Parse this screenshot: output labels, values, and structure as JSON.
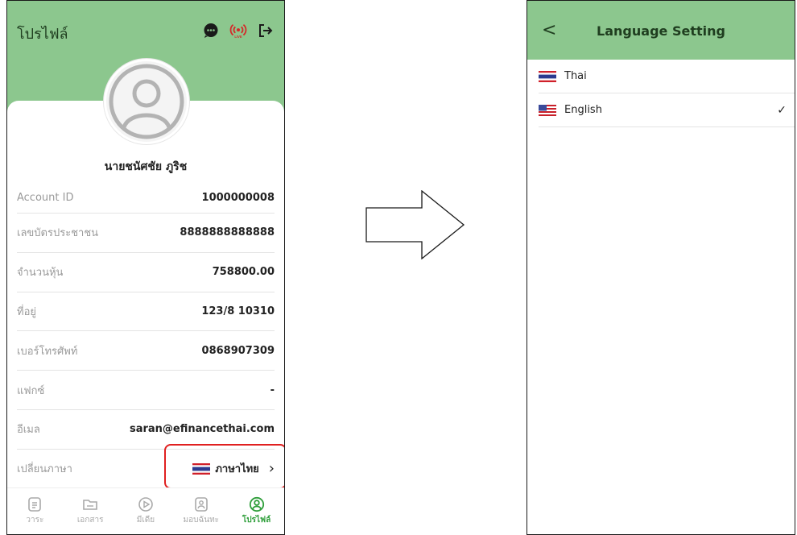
{
  "left_screen": {
    "title": "โปรไฟล์",
    "header_icons": [
      "chat-icon",
      "live-icon",
      "logout-icon"
    ],
    "live_label": "LIVE",
    "user_name": "นายชนัศชัย ภูริช",
    "info": [
      {
        "label": "Account ID",
        "value": "1000000008"
      },
      {
        "label": "เลขบัตรประชาชน",
        "value": "8888888888888"
      },
      {
        "label": "จำนวนหุ้น",
        "value": "758800.00"
      },
      {
        "label": "ที่อยู่",
        "value": "123/8 10310"
      },
      {
        "label": "เบอร์โทรศัพท์",
        "value": "0868907309"
      },
      {
        "label": "แฟกซ์",
        "value": "-"
      },
      {
        "label": "อีเมล",
        "value": "saran@efinancethai.com"
      }
    ],
    "language_row": {
      "label": "เปลี่ยนภาษา",
      "value": "ภาษาไทย",
      "chevron": "›"
    },
    "nav": [
      {
        "label": "วาระ",
        "icon": "agenda-icon"
      },
      {
        "label": "เอกสาร",
        "icon": "folder-icon"
      },
      {
        "label": "มีเดีย",
        "icon": "play-icon"
      },
      {
        "label": "มอบฉันทะ",
        "icon": "proxy-icon"
      },
      {
        "label": "โปรไฟล์",
        "icon": "profile-icon",
        "active": true
      }
    ],
    "colors": {
      "header": "#8cc78e",
      "active": "#2e9e3a",
      "highlight": "#e02020"
    }
  },
  "right_screen": {
    "back": "<",
    "title": "Language Setting",
    "languages": [
      {
        "label": "Thai",
        "flag": "thai-flag-icon",
        "selected": false
      },
      {
        "label": "English",
        "flag": "us-flag-icon",
        "selected": true
      }
    ],
    "check": "✓"
  }
}
